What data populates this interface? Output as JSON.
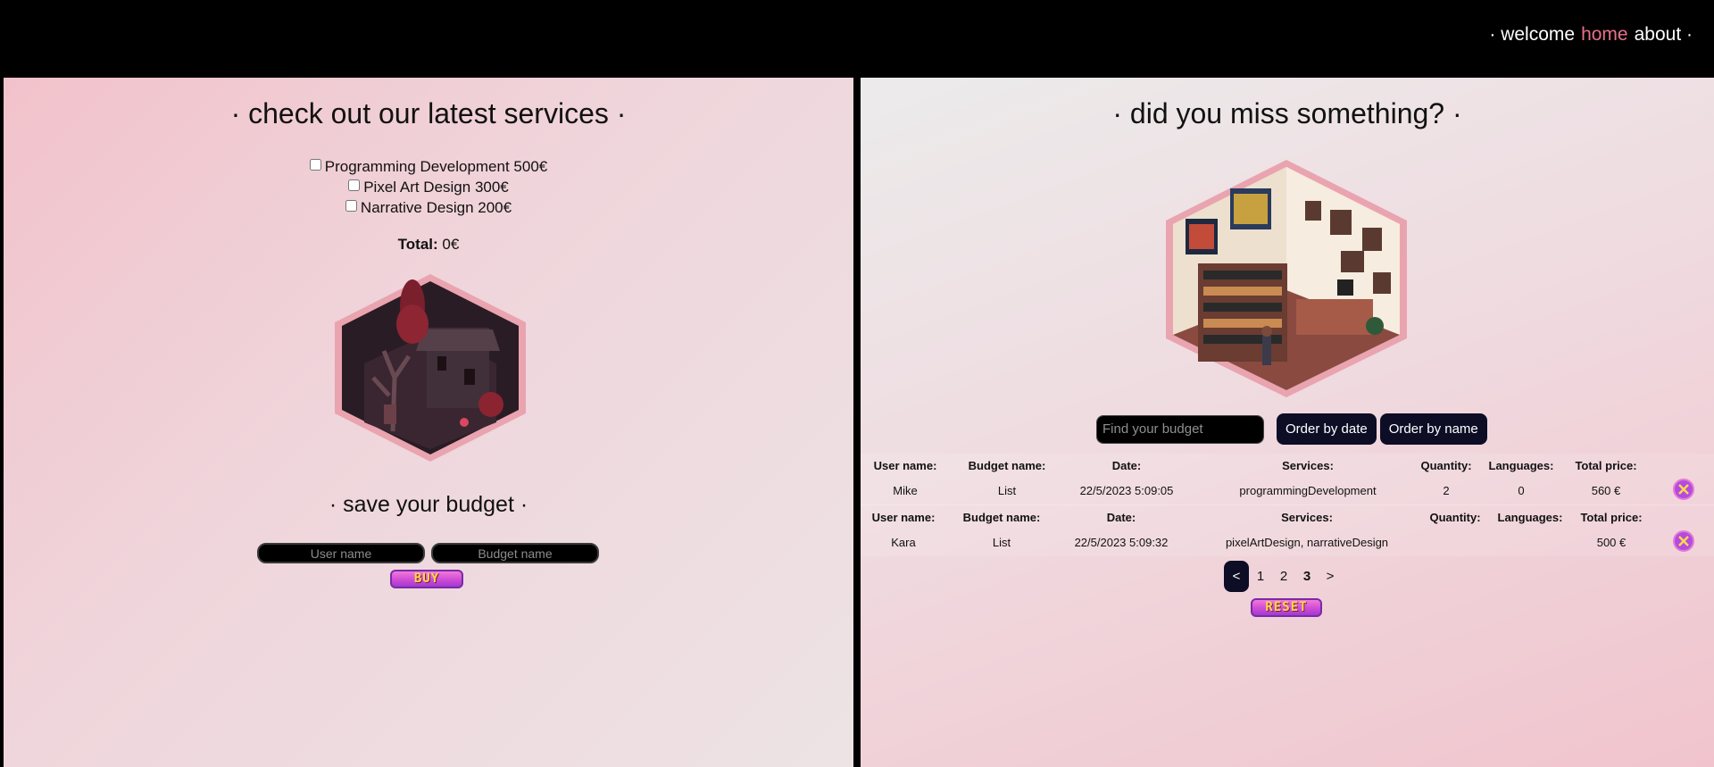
{
  "nav": {
    "items": [
      "· welcome",
      "home",
      "about ·"
    ]
  },
  "left": {
    "title": "· check out our latest services ·",
    "services": [
      {
        "label": "Programming Development 500€",
        "checked": false
      },
      {
        "label": "Pixel Art Design 300€",
        "checked": false
      },
      {
        "label": "Narrative Design 200€",
        "checked": false
      }
    ],
    "total_label": "Total:",
    "total_value": "0€",
    "save_title": "· save your budget ·",
    "user_placeholder": "User name",
    "budget_placeholder": "Budget name",
    "buy_label": "BUY"
  },
  "right": {
    "title": "· did you miss something? ·",
    "search_placeholder": "Find your budget",
    "order_date": "Order by date",
    "order_name": "Order by name",
    "headers": {
      "user": "User name:",
      "budget": "Budget name:",
      "date": "Date:",
      "services": "Services:",
      "quantity": "Quantity:",
      "languages": "Languages:",
      "price": "Total price:"
    },
    "rows": [
      {
        "user": "Mike",
        "budget": "List",
        "date": "22/5/2023 5:09:05",
        "services": "programmingDevelopment",
        "quantity": "2",
        "languages": "0",
        "price": "560 €"
      },
      {
        "user": "Kara",
        "budget": "List",
        "date": "22/5/2023 5:09:32",
        "services": "pixelArtDesign, narrativeDesign",
        "quantity": "",
        "languages": "",
        "price": "500 €"
      }
    ],
    "pagination": {
      "prev": "<",
      "pages": [
        "1",
        "2",
        "3"
      ],
      "current": "3",
      "next": ">"
    },
    "reset_label": "RESET"
  }
}
